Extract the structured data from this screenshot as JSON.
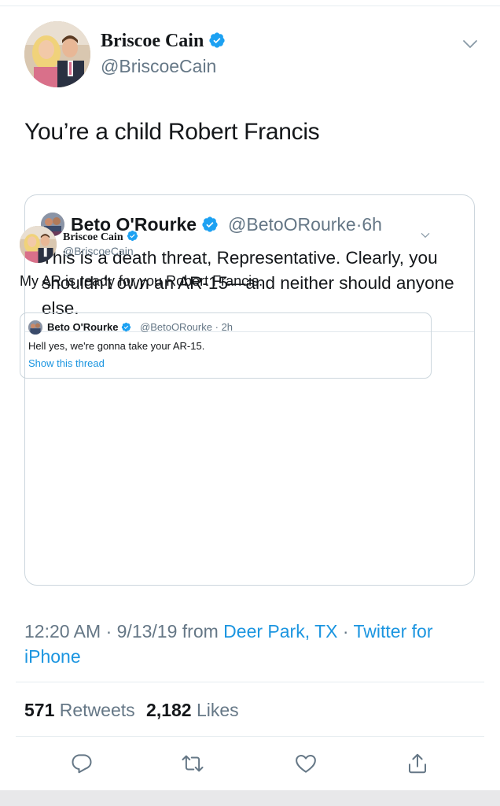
{
  "tweet": {
    "author_name": "Briscoe Cain",
    "author_handle": "@BriscoeCain",
    "text": "You’re a child Robert Francis"
  },
  "quote": {
    "author_name": "Beto O'Rourke",
    "author_handle": "@BetoORourke",
    "separator": "·",
    "time": "6h",
    "text": "This is a death threat, Representative. Clearly, you shouldn't own an AR-15—and neither should anyone else.",
    "embedded": {
      "author_name": "Briscoe Cain",
      "author_handle": "@BriscoeCain",
      "text": "My AR is ready for you Robert Francis.",
      "nested": {
        "author_name": "Beto O'Rourke",
        "author_handle": "@BetoORourke",
        "separator": "·",
        "time": "2h",
        "text": "Hell yes, we're gonna take your AR-15.",
        "link": "Show this thread"
      }
    }
  },
  "meta": {
    "time": "12:20 AM",
    "separator": "·",
    "date": "9/13/19",
    "from_label": "from",
    "location": "Deer Park, TX",
    "source": "Twitter for iPhone"
  },
  "stats": {
    "retweets_count": "571",
    "retweets_label": "Retweets",
    "likes_count": "2,182",
    "likes_label": "Likes"
  },
  "actions": {
    "reply_icon": "reply-icon",
    "retweet_icon": "retweet-icon",
    "like_icon": "heart-icon",
    "share_icon": "share-icon"
  },
  "colors": {
    "accent": "#1da1f2",
    "link": "#1b95e0",
    "secondary_text": "#657786",
    "border": "#ccd6dd"
  }
}
